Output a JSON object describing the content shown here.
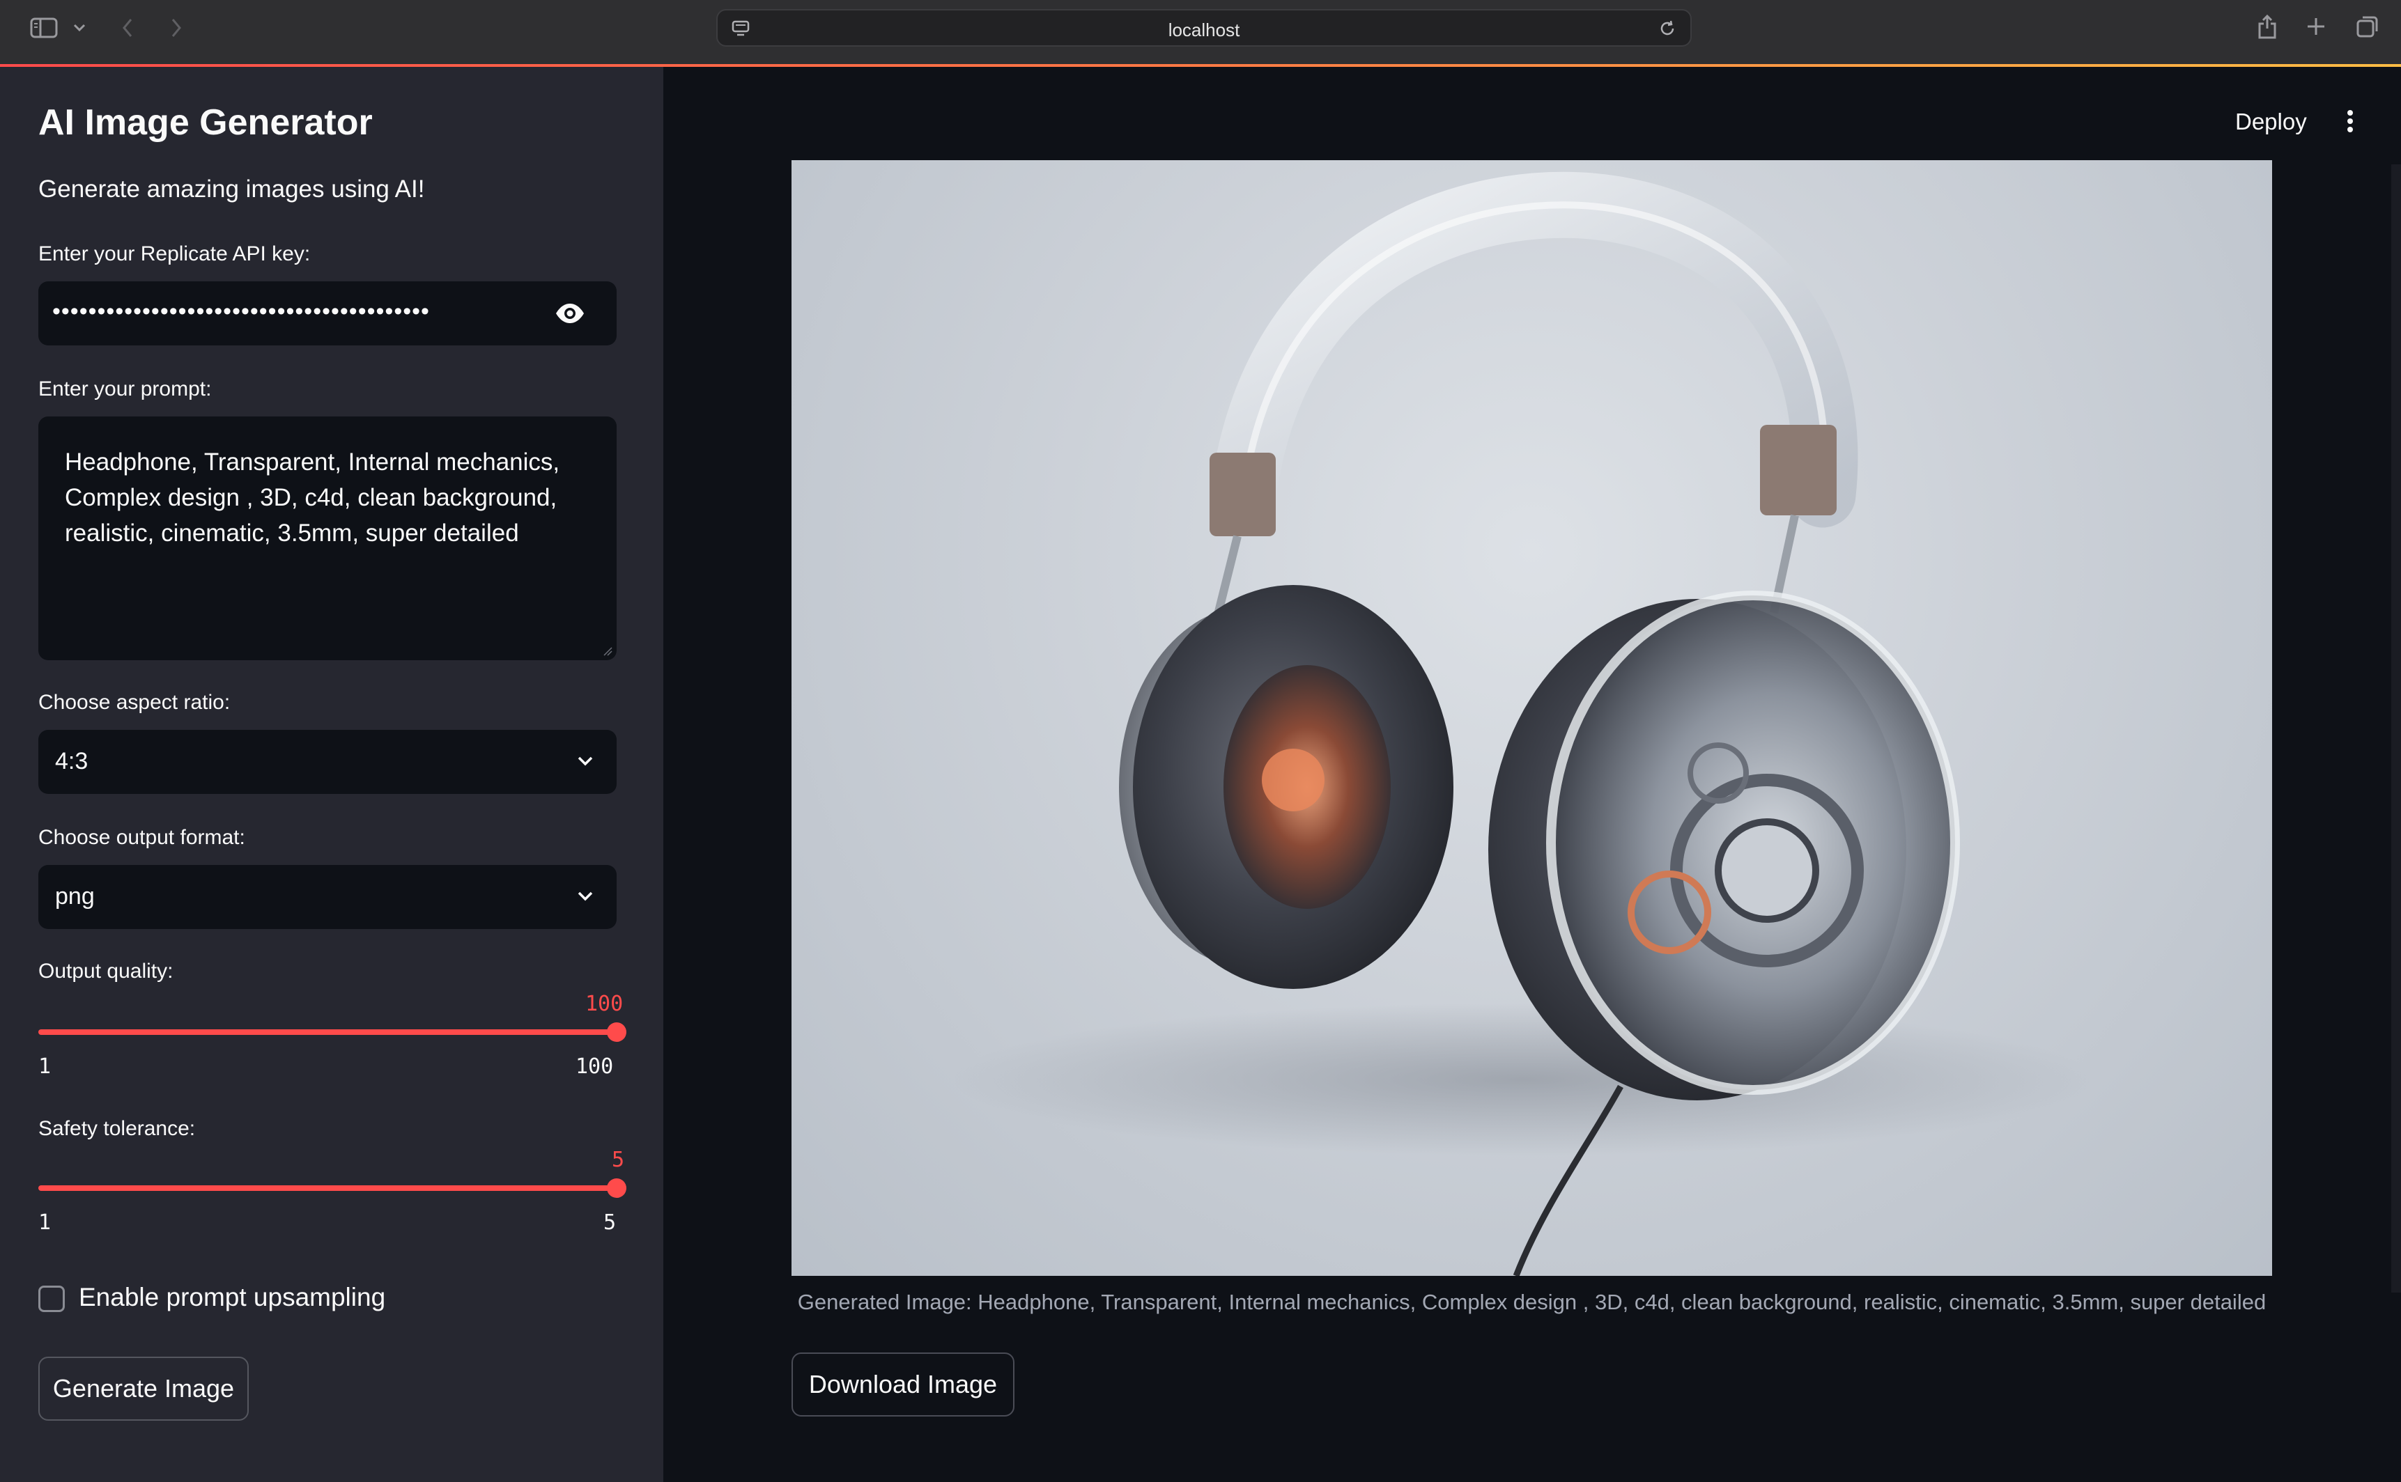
{
  "browser": {
    "url": "localhost"
  },
  "sidebar": {
    "title": "AI Image Generator",
    "subtitle": "Generate amazing images using AI!",
    "api_key": {
      "label": "Enter your Replicate API key:",
      "masked_value": "••••••••••••••••••••••••••••••••••••••••••"
    },
    "prompt": {
      "label": "Enter your prompt:",
      "value": "Headphone, Transparent, Internal mechanics, Complex design , 3D, c4d, clean background, realistic, cinematic, 3.5mm, super detailed"
    },
    "aspect_ratio": {
      "label": "Choose aspect ratio:",
      "value": "4:3"
    },
    "output_format": {
      "label": "Choose output format:",
      "value": "png"
    },
    "output_quality": {
      "label": "Output quality:",
      "value": "100",
      "min": "1",
      "max": "100",
      "fraction": 1.0
    },
    "safety_tolerance": {
      "label": "Safety tolerance:",
      "value": "5",
      "min": "1",
      "max": "5",
      "fraction": 1.0
    },
    "upsampling": {
      "label": "Enable prompt upsampling",
      "checked": false
    },
    "generate_button": "Generate Image"
  },
  "main": {
    "deploy_label": "Deploy",
    "caption": "Generated Image: Headphone, Transparent, Internal mechanics, Complex design , 3D, c4d, clean background,   realistic, cinematic, 3.5mm, super detailed",
    "download_button": "Download Image"
  },
  "colors": {
    "accent": "#ff4b4b",
    "sidebar_bg": "#262730",
    "main_bg": "#0e1117"
  }
}
